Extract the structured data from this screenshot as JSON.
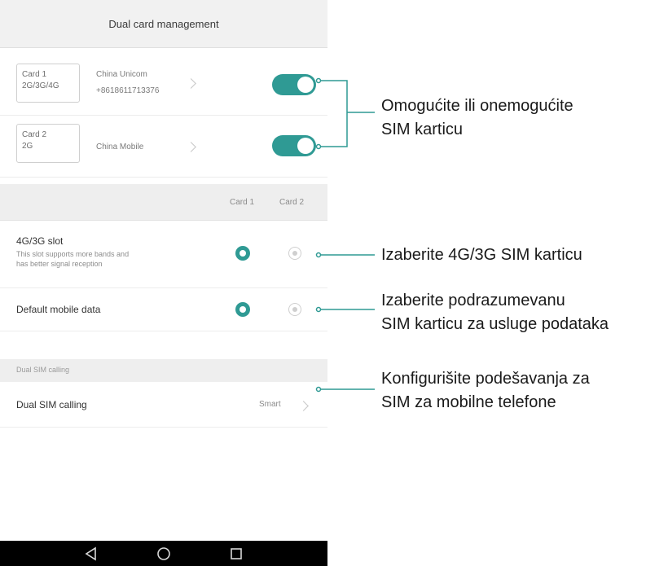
{
  "header": {
    "title": "Dual card management"
  },
  "sims": [
    {
      "badge_line1": "Card 1",
      "badge_line2": "2G/3G/4G",
      "carrier": "China Unicom",
      "number": "+8618611713376",
      "enabled": true
    },
    {
      "badge_line1": "Card 2",
      "badge_line2": "2G",
      "carrier": "China Mobile",
      "number": "",
      "enabled": true
    }
  ],
  "columns": {
    "card1": "Card 1",
    "card2": "Card 2"
  },
  "slot_row": {
    "title": "4G/3G slot",
    "subtitle_line1": "This slot supports more bands and",
    "subtitle_line2": "has better signal reception",
    "selected": "card1"
  },
  "data_row": {
    "title": "Default mobile data",
    "selected": "card1"
  },
  "calling_section": {
    "header": "Dual SIM calling"
  },
  "calling_row": {
    "title": "Dual SIM calling",
    "value": "Smart"
  },
  "callouts": [
    {
      "line1": "Omogućite ili onemogućite",
      "line2": "SIM karticu"
    },
    {
      "line1": "Izaberite 4G/3G SIM karticu",
      "line2": ""
    },
    {
      "line1": "Izaberite podrazumevanu",
      "line2": "SIM karticu za usluge podataka"
    },
    {
      "line1": "Konfigurišite podešavanja za",
      "line2": "SIM za mobilne telefone"
    }
  ],
  "colors": {
    "accent": "#2f9a94",
    "navbar": "#000000"
  },
  "icons": {
    "back": "back-triangle-icon",
    "home": "home-circle-icon",
    "recents": "recents-square-icon"
  }
}
